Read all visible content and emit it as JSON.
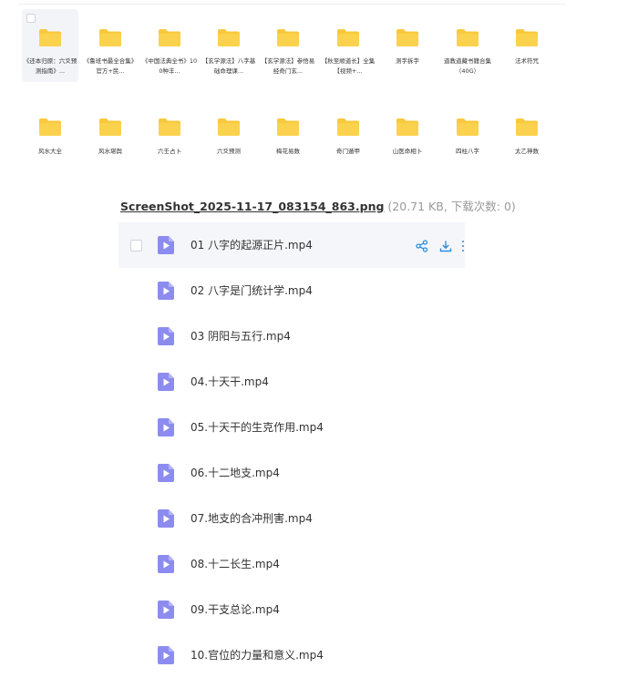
{
  "folders": [
    {
      "name": "《还本归原：六爻预测指南》...",
      "selected": true
    },
    {
      "name": "《鲁班书最全合集》官方+民..."
    },
    {
      "name": "《中国法典全书》100种丰..."
    },
    {
      "name": "【玄学源法】八字基础命理课..."
    },
    {
      "name": "【玄学源法】参悟易经奇门玄..."
    },
    {
      "name": "【秋至顺道长】全集【视频+..."
    },
    {
      "name": "测字拆字"
    },
    {
      "name": "道教道藏书籍合集（40G）"
    },
    {
      "name": "法术符咒"
    },
    {
      "name": "风水大全"
    },
    {
      "name": "风水堪舆"
    },
    {
      "name": "六壬占卜"
    },
    {
      "name": "六爻预测"
    },
    {
      "name": "梅花易数"
    },
    {
      "name": "奇门遁甲"
    },
    {
      "name": "山医命相卜"
    },
    {
      "name": "四柱八字"
    },
    {
      "name": "太乙神数"
    }
  ],
  "file_header": {
    "name": "ScreenShot_2025-11-17_083154_863.png",
    "meta": " (20.71 KB, 下载次数: 0)"
  },
  "files": [
    {
      "name": "01 八字的起源正片.mp4"
    },
    {
      "name": "02 八字是门统计学.mp4"
    },
    {
      "name": "03 阴阳与五行.mp4"
    },
    {
      "name": "04.十天干.mp4"
    },
    {
      "name": "05.十天干的生克作用.mp4"
    },
    {
      "name": "06.十二地支.mp4"
    },
    {
      "name": "07.地支的合冲刑害.mp4"
    },
    {
      "name": "08.十二长生.mp4"
    },
    {
      "name": "09.干支总论.mp4"
    },
    {
      "name": "10.官位的力量和意义.mp4"
    }
  ],
  "icons": {
    "folder": "folder-icon",
    "video": "video-file-icon",
    "share": "share-icon",
    "download": "download-icon"
  },
  "colors": {
    "folder": "#f9c93d",
    "video_icon": "#8c8cf0",
    "action_icon": "#2a8fe0"
  }
}
